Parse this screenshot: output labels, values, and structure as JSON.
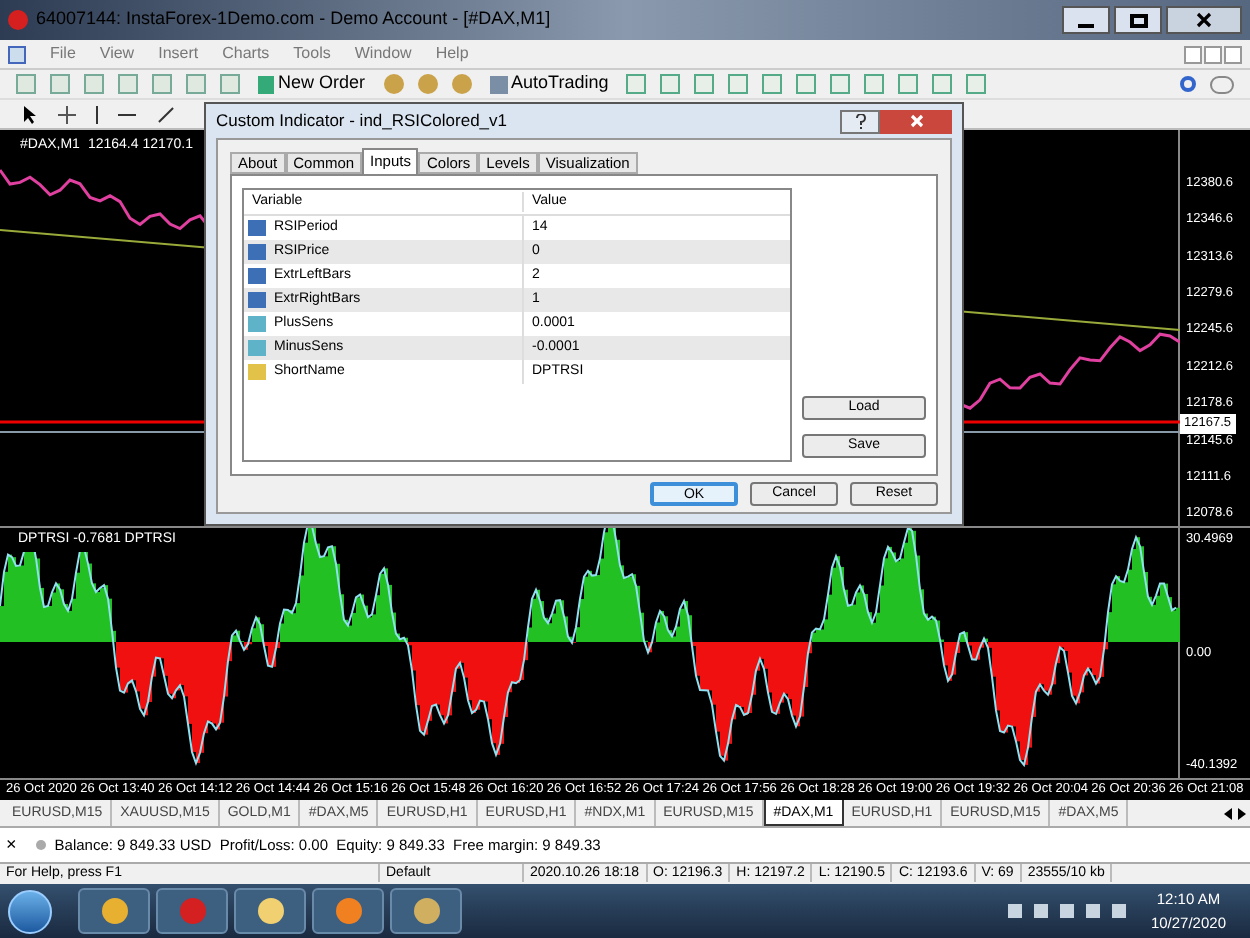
{
  "window": {
    "title": "64007144: InstaForex-1Demo.com - Demo Account - [#DAX,M1]"
  },
  "menu": [
    "File",
    "View",
    "Insert",
    "Charts",
    "Tools",
    "Window",
    "Help"
  ],
  "toolbar": {
    "new_order": "New Order",
    "auto_trading": "AutoTrading"
  },
  "chart": {
    "header_symbol": "#DAX,M1",
    "header_prices": "12164.4 12170.1",
    "price_labels": [
      "12380.6",
      "12346.6",
      "12313.6",
      "12279.6",
      "12245.6",
      "12212.6",
      "12178.6",
      "12145.6",
      "12111.6",
      "12078.6"
    ],
    "current_price": "12167.5",
    "indicator_label": "DPTRSI -0.7681 DPTRSI",
    "indicator_labels": [
      "30.4969",
      "0.00",
      "-40.1392"
    ],
    "time_labels": [
      "26 Oct 2020",
      "26 Oct 13:40",
      "26 Oct 14:12",
      "26 Oct 14:44",
      "26 Oct 15:16",
      "26 Oct 15:48",
      "26 Oct 16:20",
      "26 Oct 16:52",
      "26 Oct 17:24",
      "26 Oct 17:56",
      "26 Oct 18:28",
      "26 Oct 19:00",
      "26 Oct 19:32",
      "26 Oct 20:04",
      "26 Oct 20:36",
      "26 Oct 21:08"
    ]
  },
  "dialog": {
    "title": "Custom Indicator - ind_RSIColored_v1",
    "tabs": [
      {
        "label": "About",
        "selected": false
      },
      {
        "label": "Common",
        "selected": false
      },
      {
        "label": "Inputs",
        "selected": true
      },
      {
        "label": "Colors",
        "selected": false
      },
      {
        "label": "Levels",
        "selected": false
      },
      {
        "label": "Visualization",
        "selected": false
      }
    ],
    "columns": [
      "Variable",
      "Value"
    ],
    "rows": [
      {
        "kind": "int",
        "variable": "RSIPeriod",
        "value": "14"
      },
      {
        "kind": "int",
        "variable": "RSIPrice",
        "value": "0"
      },
      {
        "kind": "int",
        "variable": "ExtrLeftBars",
        "value": "2"
      },
      {
        "kind": "int",
        "variable": "ExtrRightBars",
        "value": "1"
      },
      {
        "kind": "double",
        "variable": "PlusSens",
        "value": "0.0001"
      },
      {
        "kind": "double",
        "variable": "MinusSens",
        "value": "-0.0001"
      },
      {
        "kind": "string",
        "variable": "ShortName",
        "value": "DPTRSI"
      }
    ],
    "side_buttons": [
      "Load",
      "Save"
    ],
    "buttons": [
      {
        "label": "OK",
        "default": true
      },
      {
        "label": "Cancel",
        "default": false
      },
      {
        "label": "Reset",
        "default": false
      }
    ]
  },
  "chart_tabs": [
    {
      "label": "EURUSD,M15",
      "selected": false
    },
    {
      "label": "XAUUSD,M15",
      "selected": false
    },
    {
      "label": "GOLD,M1",
      "selected": false
    },
    {
      "label": "#DAX,M5",
      "selected": false
    },
    {
      "label": "EURUSD,H1",
      "selected": false
    },
    {
      "label": "EURUSD,H1",
      "selected": false
    },
    {
      "label": "#NDX,M1",
      "selected": false
    },
    {
      "label": "EURUSD,M15",
      "selected": false
    },
    {
      "label": "#DAX,M1",
      "selected": true
    },
    {
      "label": "EURUSD,H1",
      "selected": false
    },
    {
      "label": "EURUSD,M15",
      "selected": false
    },
    {
      "label": "#DAX,M5",
      "selected": false
    }
  ],
  "terminal": {
    "close": "×",
    "summary": "Balance: 9 849.33 USD  Profit/Loss: 0.00  Equity: 9 849.33  Free margin: 9 849.33"
  },
  "status_bar": [
    "For Help, press F1",
    "Default",
    "2020.10.26 18:18",
    "O: 12196.3",
    "H: 12197.2",
    "L: 12190.5",
    "C: 12193.6",
    "V: 69",
    "23555/10 kb"
  ],
  "taskbar": {
    "time": "12:10 AM",
    "date": "10/27/2020"
  }
}
